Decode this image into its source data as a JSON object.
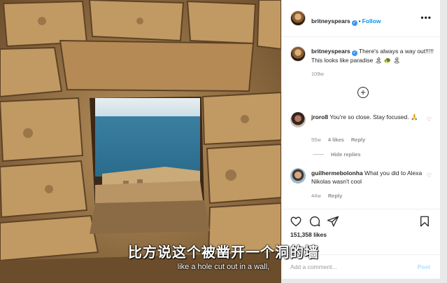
{
  "colors": {
    "accent": "#0095f6",
    "verified": "#3897f0",
    "text": "#262626",
    "muted": "#8e8e8e"
  },
  "post": {
    "author": "britneyspears",
    "verified": true,
    "follow_label": "Follow",
    "more_label": "•••",
    "caption": "There's always a way out!!!!! This looks like paradise 🏝 🐢 🏝",
    "caption_age": "109w",
    "load_more_label": "+",
    "likes": "151,358 likes"
  },
  "comments": [
    {
      "user": "jroro8",
      "text": "You're so close. Stay focused. 🙏",
      "age": "55w",
      "likes": "4 likes",
      "reply": "Reply",
      "hide_replies": "Hide replies"
    },
    {
      "user": "guilhermebolonha",
      "text": "What you did to Alexa Nikolas wasn't cool",
      "age": "44w",
      "reply": "Reply"
    }
  ],
  "compose": {
    "placeholder": "Add a comment...",
    "post_label": "Post"
  },
  "icons": [
    "heart-icon",
    "comment-icon",
    "share-icon",
    "bookmark-icon",
    "more-icon",
    "verified-icon",
    "add-circle-icon"
  ],
  "subtitles": {
    "chinese": "比方说这个被凿开一个洞的墙",
    "english": "like a hole cut out in a wall,"
  }
}
